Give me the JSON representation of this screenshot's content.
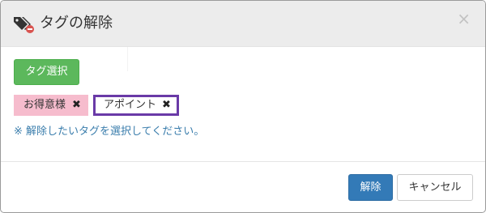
{
  "modal": {
    "title": "タグの解除",
    "header_icon": "tags-remove-icon",
    "close_label": "×"
  },
  "body": {
    "select_button_label": "タグ選択",
    "tags": [
      {
        "label": "お得意様",
        "remove": "✖",
        "color": "#f6bccd",
        "highlighted": false
      },
      {
        "label": "アポイント",
        "remove": "✖",
        "color": "#ffffff",
        "highlighted": true,
        "highlight_color": "#6a3aa7"
      }
    ],
    "hint": "※ 解除したいタグを選択してください。"
  },
  "footer": {
    "release_label": "解除",
    "cancel_label": "キャンセル"
  },
  "colors": {
    "primary": "#337ab7",
    "success": "#5cb85c",
    "hint_text": "#3a7dac"
  }
}
